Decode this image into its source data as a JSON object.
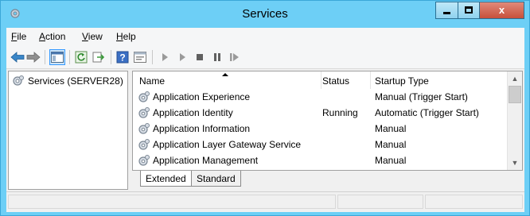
{
  "window": {
    "title": "Services",
    "close_glyph": "x"
  },
  "menu": [
    {
      "label": "File",
      "accel": "F",
      "rest": "ile"
    },
    {
      "label": "Action",
      "accel": "A",
      "rest": "ction"
    },
    {
      "label": "View",
      "accel": "V",
      "rest": "iew"
    },
    {
      "label": "Help",
      "accel": "H",
      "rest": "elp"
    }
  ],
  "toolbar": {
    "icons": [
      "back-arrow-icon",
      "forward-arrow-icon",
      "show-hide-tree-icon",
      "refresh-icon",
      "export-list-icon",
      "help-icon",
      "properties-icon",
      "start-service-icon",
      "start-service-alt-icon",
      "stop-service-icon",
      "pause-service-icon",
      "restart-service-icon"
    ]
  },
  "tree": {
    "root_label": "Services (SERVER28)"
  },
  "list": {
    "columns": {
      "name": "Name",
      "status": "Status",
      "startup_type": "Startup Type"
    },
    "rows": [
      {
        "name": "Application Experience",
        "status": "",
        "startup_type": "Manual (Trigger Start)"
      },
      {
        "name": "Application Identity",
        "status": "Running",
        "startup_type": "Automatic (Trigger Start)"
      },
      {
        "name": "Application Information",
        "status": "",
        "startup_type": "Manual"
      },
      {
        "name": "Application Layer Gateway Service",
        "status": "",
        "startup_type": "Manual"
      },
      {
        "name": "Application Management",
        "status": "",
        "startup_type": "Manual"
      }
    ]
  },
  "tabs": [
    {
      "label": "Extended",
      "selected": true
    },
    {
      "label": "Standard",
      "selected": false
    }
  ],
  "colors": {
    "frame": "#6dcff6",
    "close_button": "#c7503b",
    "link_blue": "#1e73be"
  }
}
